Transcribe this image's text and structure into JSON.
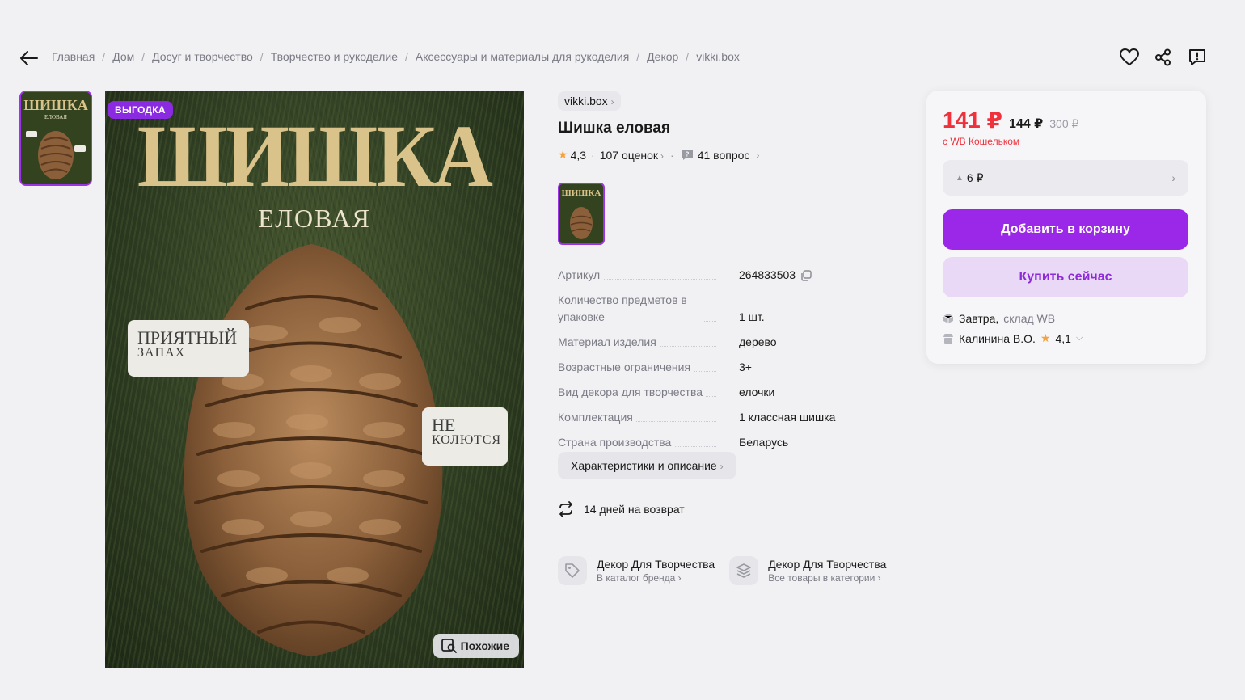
{
  "breadcrumb": [
    "Главная",
    "Дом",
    "Досуг и творчество",
    "Творчество и рукоделие",
    "Аксессуары и материалы для рукоделия",
    "Декор",
    "vikki.box"
  ],
  "hero": {
    "badge": "ВЫГОДКА",
    "title": "ШИШКА",
    "subtitle": "ЕЛОВАЯ",
    "card1_big": "ПРИЯТНЫЙ",
    "card1_small": "ЗАПАХ",
    "card2_big": "НЕ",
    "card2_small": "КОЛЮТСЯ",
    "similar_label": "Похожие"
  },
  "thumb": {
    "title": "ШИШКА",
    "sub": "ЕЛОВАЯ"
  },
  "product": {
    "brand": "vikki.box",
    "title": "Шишка еловая",
    "rating": "4,3",
    "reviews": "107 оценок",
    "questions": "41 вопрос"
  },
  "specs": [
    {
      "key": "Артикул",
      "value": "264833503",
      "copy": true
    },
    {
      "key": "Количество предметов в упаковке",
      "value": "1 шт."
    },
    {
      "key": "Материал изделия",
      "value": "дерево"
    },
    {
      "key": "Возрастные ограничения",
      "value": "3+"
    },
    {
      "key": "Вид декора для творчества",
      "value": "елочки"
    },
    {
      "key": "Комплектация",
      "value": "1 классная шишка"
    },
    {
      "key": "Страна производства",
      "value": "Беларусь"
    }
  ],
  "chars_button": "Характеристики и описание",
  "return_text": "14 дней на возврат",
  "brand_links": [
    {
      "title": "Декор Для Творчества",
      "subtitle": "В каталог бренда",
      "icon": "tag-icon"
    },
    {
      "title": "Декор Для Творчества",
      "subtitle": "Все товары в категории",
      "icon": "layers-icon"
    }
  ],
  "price": {
    "current": "141 ₽",
    "mid": "144 ₽",
    "old": "300 ₽",
    "wallet_note": "с WB Кошельком",
    "discount": "6 ₽",
    "add_to_cart": "Добавить в корзину",
    "buy_now": "Купить сейчас",
    "delivery_strong": "Завтра,",
    "delivery_muted": "склад WB",
    "seller": "Калинина В.О.",
    "seller_rating": "4,1"
  },
  "colors": {
    "accent": "#9b27e8",
    "price": "#f0313b",
    "star": "#f4a23c"
  }
}
